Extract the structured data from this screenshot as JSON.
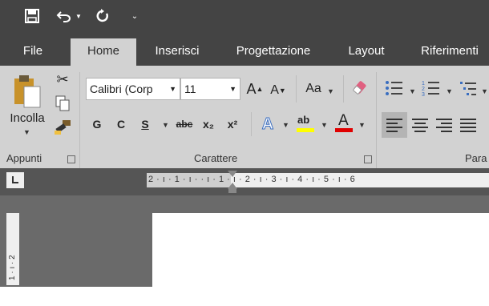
{
  "tabs": [
    "File",
    "Home",
    "Inserisci",
    "Progettazione",
    "Layout",
    "Riferimenti"
  ],
  "clipboard": {
    "paste_label": "Incolla",
    "group_label": "Appunti"
  },
  "font": {
    "name": "Calibri (Corp",
    "size": "11",
    "group_label": "Carattere"
  },
  "format_buttons": {
    "bold": "G",
    "italic": "C",
    "underline": "S",
    "strike": "abc",
    "sub": "x₂",
    "sup": "x²",
    "aa": "Aa"
  },
  "paragraph": {
    "group_label": "Para"
  },
  "ruler": {
    "hticks": "2 · ı · 1 · ı ·   · ı · 1 · ı · 2 · ı · 3 · ı · 4 · ı · 5 · ı · 6",
    "vticks": "1 · ı · 2"
  },
  "colors": {
    "qat_bg": "#444444",
    "ribbon_bg": "#d2d2d2",
    "highlight": "#ffff00",
    "font_color": "#e00000"
  }
}
